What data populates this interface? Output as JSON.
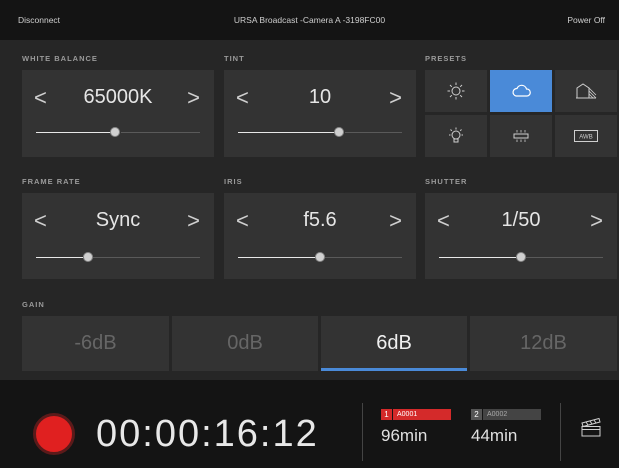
{
  "topbar": {
    "disconnect_label": "Disconnect",
    "camera_title": "URSA Broadcast -Camera A -3198FC00",
    "power_off_label": "Power Off"
  },
  "white_balance": {
    "label": "WHITE BALANCE",
    "value": "65000K",
    "slider_fraction": 0.5
  },
  "tint": {
    "label": "TINT",
    "value": "10",
    "slider_fraction": 0.6
  },
  "presets": {
    "label": "PRESETS",
    "items": [
      {
        "icon": "sun-icon",
        "active": false
      },
      {
        "icon": "cloud-icon",
        "active": true
      },
      {
        "icon": "shade-icon",
        "active": false
      },
      {
        "icon": "bulb-icon",
        "active": false
      },
      {
        "icon": "fluorescent-icon",
        "active": false
      },
      {
        "icon": "awb-icon",
        "label": "AWB",
        "active": false
      }
    ]
  },
  "frame_rate": {
    "label": "FRAME RATE",
    "value": "Sync",
    "slider_fraction": 0.3
  },
  "iris": {
    "label": "IRIS",
    "value": "f5.6",
    "slider_fraction": 0.5
  },
  "shutter": {
    "label": "SHUTTER",
    "value": "1/50",
    "slider_fraction": 0.5
  },
  "gain": {
    "label": "GAIN",
    "options": [
      "-6dB",
      "0dB",
      "6dB",
      "12dB"
    ],
    "selected": "6dB"
  },
  "bottom": {
    "timecode": "00:00:16:12",
    "card1": {
      "slot": "1",
      "name": "A0001",
      "remaining": "96min",
      "color": "#d42a2a"
    },
    "card2": {
      "slot": "2",
      "name": "A0002",
      "remaining": "44min",
      "color": "#444444"
    }
  },
  "colors": {
    "accent": "#4a8ad8",
    "record": "#e02020"
  }
}
